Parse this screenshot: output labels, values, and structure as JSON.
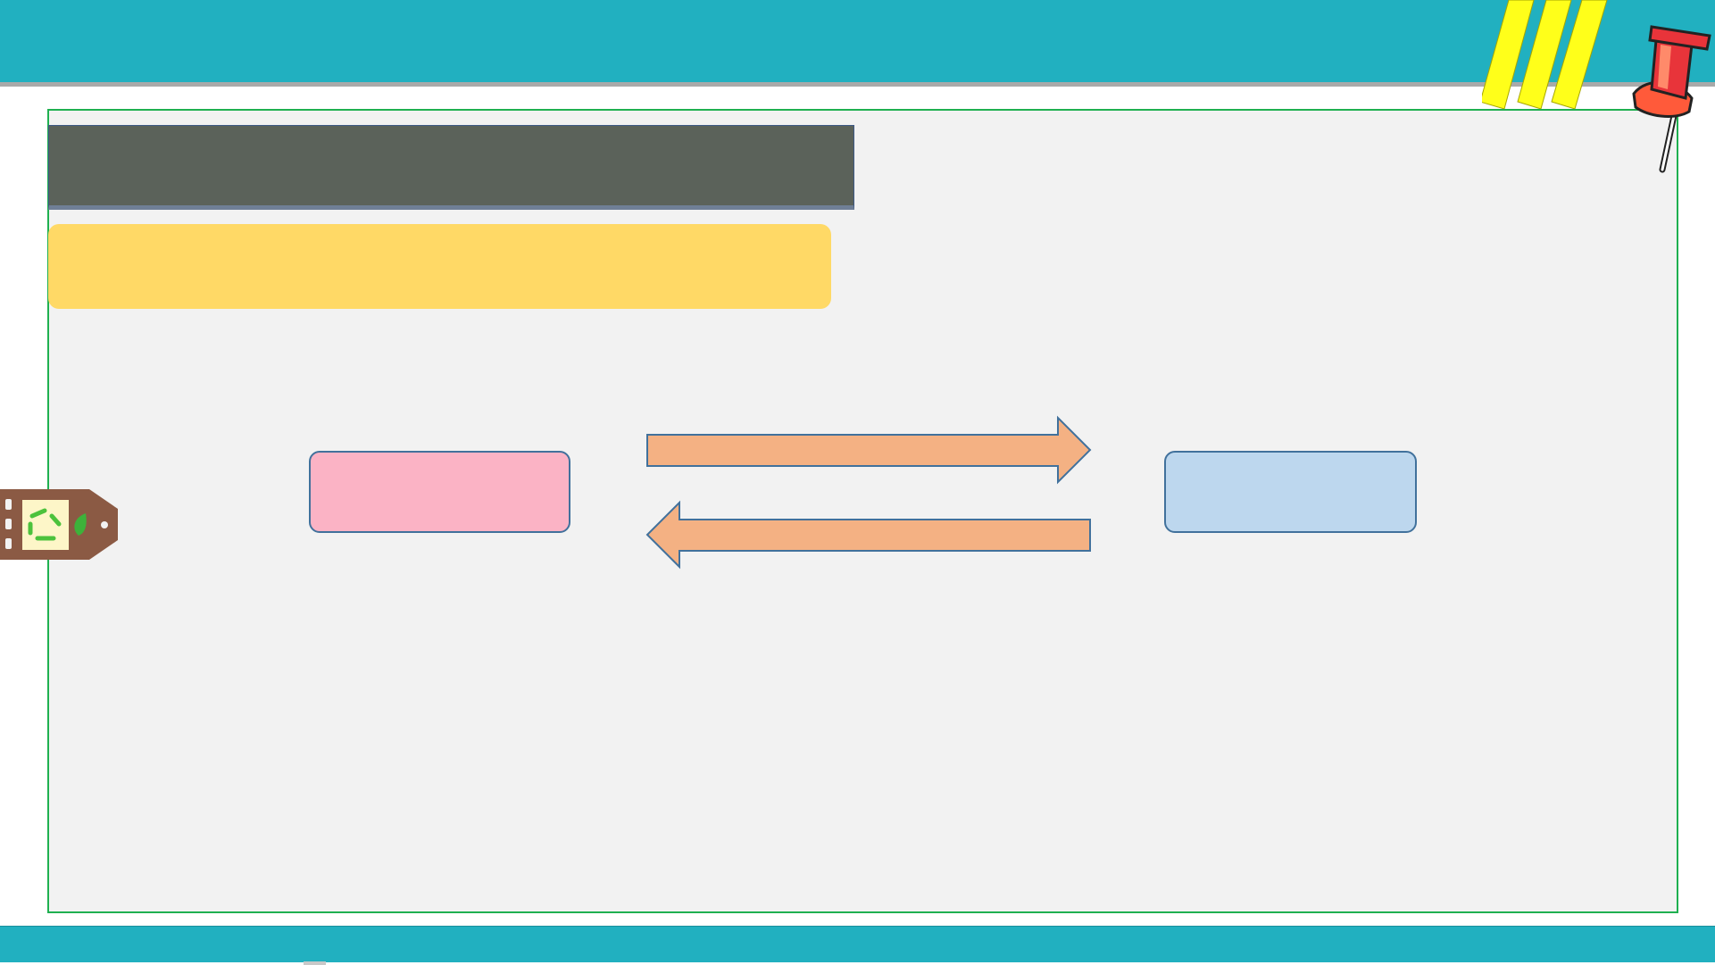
{
  "slide": {
    "title": "",
    "subtitle": "",
    "left_box_label": "",
    "right_box_label": ""
  },
  "colors": {
    "band": "#21b0c0",
    "frame_border": "#1fb050",
    "frame_fill": "#f2f2f2",
    "title_bar": "#5b625a",
    "yellow_bar": "#ffd966",
    "pink_box": "#fbb3c5",
    "blue_box": "#bdd7ee",
    "arrow_fill": "#f4b183",
    "outline": "#41719c"
  },
  "icons": {
    "pin": "push-pin-icon",
    "stripes": "yellow-stripes-decoration",
    "tag": "recycle-tag-icon"
  }
}
